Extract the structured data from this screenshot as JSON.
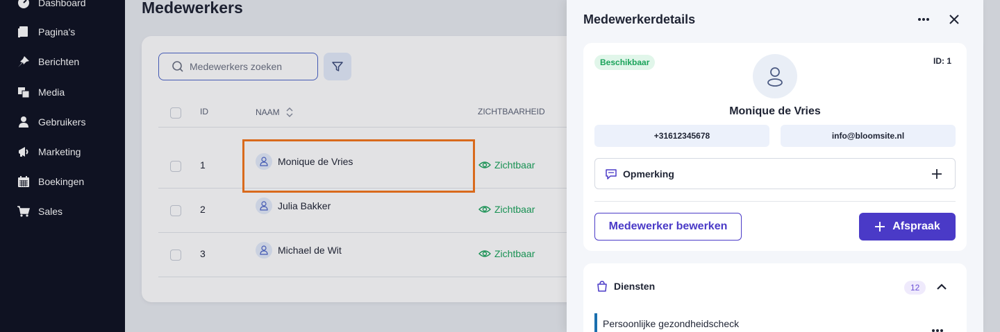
{
  "sidebar": {
    "items": [
      {
        "label": "Dashboard",
        "icon": "dashboard-icon"
      },
      {
        "label": "Pagina's",
        "icon": "pages-icon"
      },
      {
        "label": "Berichten",
        "icon": "pin-icon"
      },
      {
        "label": "Media",
        "icon": "media-icon"
      },
      {
        "label": "Gebruikers",
        "icon": "user-icon"
      },
      {
        "label": "Marketing",
        "icon": "megaphone-icon"
      },
      {
        "label": "Boekingen",
        "icon": "calendar-icon"
      },
      {
        "label": "Sales",
        "icon": "cart-icon"
      }
    ]
  },
  "main": {
    "title": "Medewerkers",
    "search": {
      "placeholder": "Medewerkers zoeken"
    },
    "table": {
      "headers": {
        "id": "ID",
        "name": "NAAM",
        "visibility": "ZICHTBAARHEID"
      },
      "rows": [
        {
          "id": "1",
          "name": "Monique de Vries",
          "visibility": "Zichtbaar"
        },
        {
          "id": "2",
          "name": "Julia Bakker",
          "visibility": "Zichtbaar"
        },
        {
          "id": "3",
          "name": "Michael de Wit",
          "visibility": "Zichtbaar"
        }
      ]
    }
  },
  "drawer": {
    "title": "Medewerkerdetails",
    "status": "Beschikbaar",
    "id_label": "ID: 1",
    "name": "Monique de Vries",
    "phone": "+31612345678",
    "email": "info@bloomsite.nl",
    "note_label": "Opmerking",
    "edit_button": "Medewerker bewerken",
    "appointment_button": "Afspraak",
    "services": {
      "label": "Diensten",
      "count": "12",
      "items": [
        "Persoonlijke gezondheidscheck"
      ]
    }
  },
  "colors": {
    "sidebar_bg": "#0f1323",
    "primary": "#4a3ac7",
    "success": "#1aa35a",
    "highlight": "#d96a1c"
  }
}
